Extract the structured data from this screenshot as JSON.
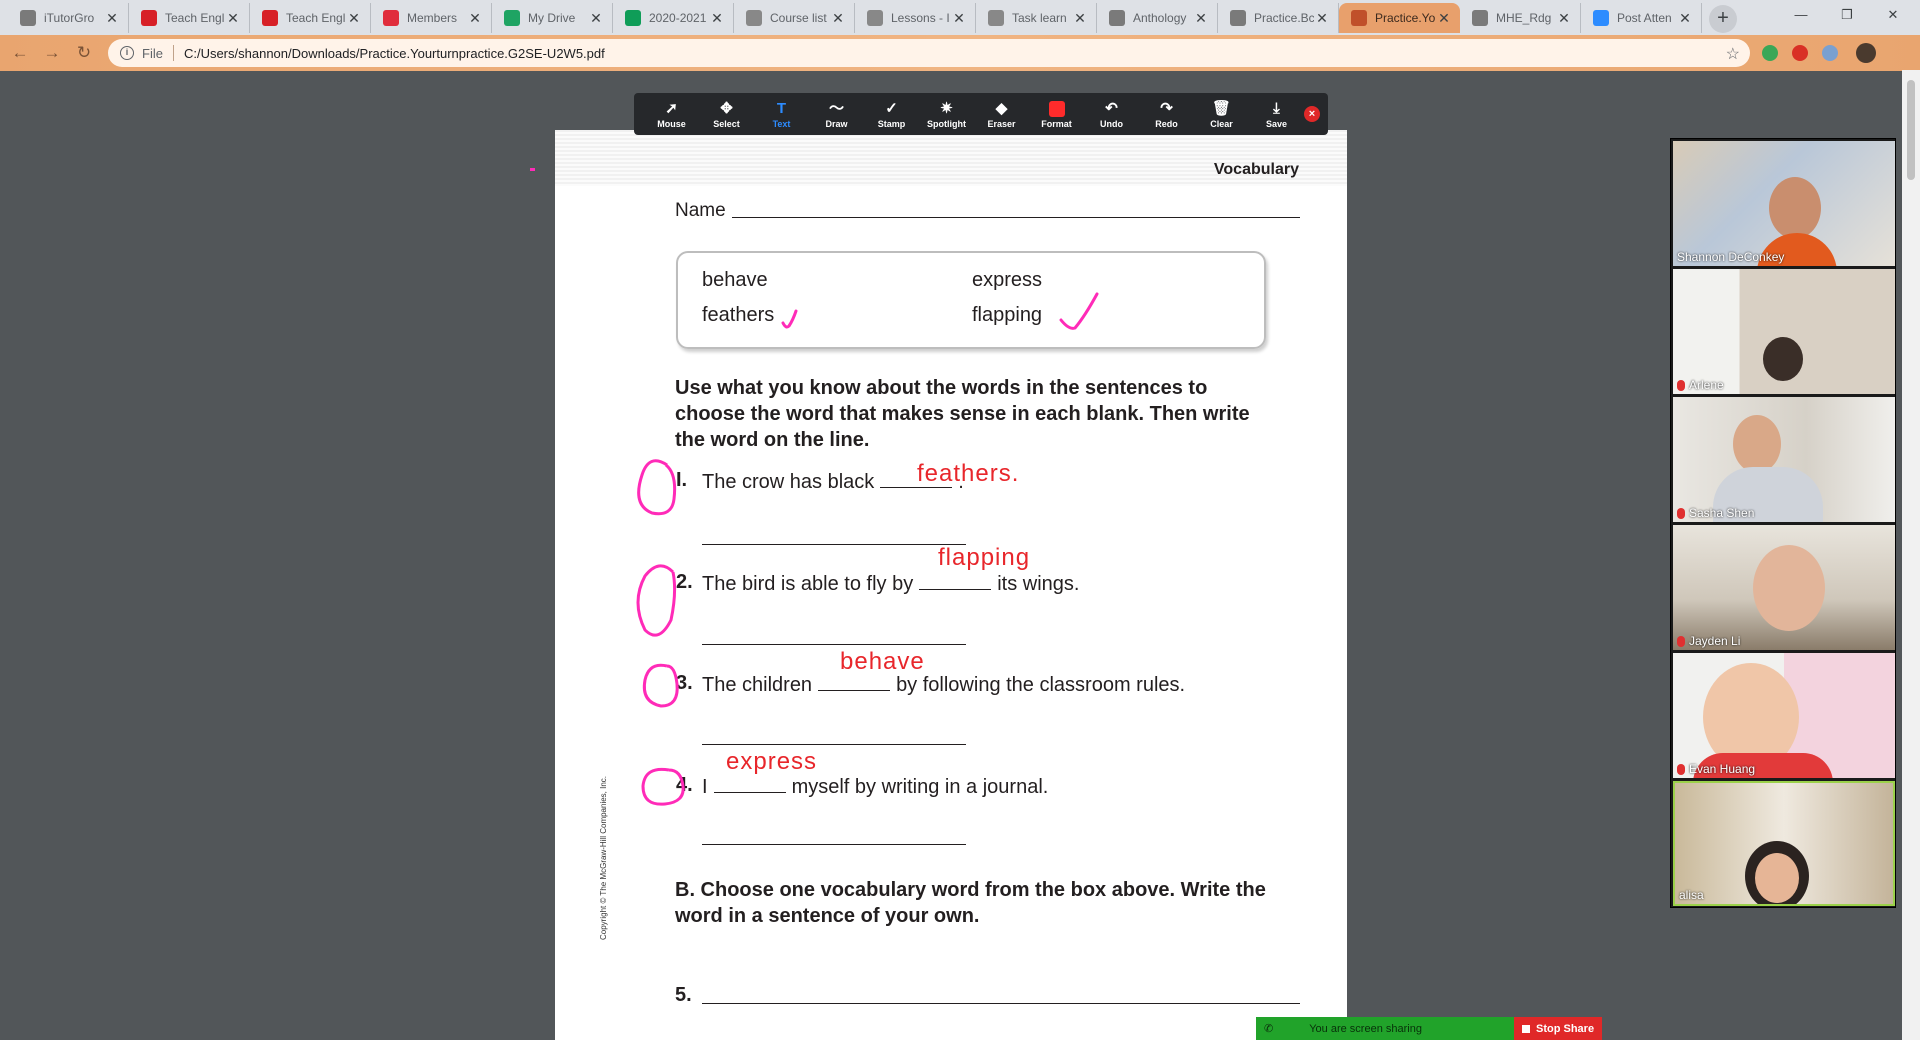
{
  "browser": {
    "tabs": [
      {
        "title": "iTutorGro",
        "icon": "globe-icon",
        "color": "#7a7a7a"
      },
      {
        "title": "Teach Engl",
        "icon": "i-brand-icon",
        "color": "#d72027"
      },
      {
        "title": "Teach Engl",
        "icon": "i-brand-icon",
        "color": "#d72027"
      },
      {
        "title": "Members",
        "icon": "members-icon",
        "color": "#e02d3c"
      },
      {
        "title": "My Drive",
        "icon": "drive-icon",
        "color": "#1fa463"
      },
      {
        "title": "2020-2021",
        "icon": "sheets-icon",
        "color": "#0f9d58"
      },
      {
        "title": "Course list",
        "icon": "doc-icon",
        "color": "#888888"
      },
      {
        "title": "Lessons - I",
        "icon": "doc-icon",
        "color": "#888888"
      },
      {
        "title": "Task learn",
        "icon": "doc-icon",
        "color": "#888888"
      },
      {
        "title": "Anthology",
        "icon": "globe-icon",
        "color": "#7a7a7a"
      },
      {
        "title": "Practice.Bc",
        "icon": "globe-icon",
        "color": "#7a7a7a"
      },
      {
        "title": "Practice.Yo",
        "icon": "pdf-icon",
        "color": "#c0502a"
      },
      {
        "title": "MHE_Rdg",
        "icon": "globe-icon",
        "color": "#7a7a7a"
      },
      {
        "title": "Post Atten",
        "icon": "zoom-icon",
        "color": "#2d8cff"
      }
    ],
    "new_tab": "+",
    "file_label": "File",
    "url": "C:/Users/shannon/Downloads/Practice.Yourturnpractice.G2SE-U2W5.pdf",
    "accent": "#e8a06c"
  },
  "annotation_toolbar": {
    "tools": [
      {
        "label": "Mouse",
        "icon": "cursor-icon",
        "glyph": "➚"
      },
      {
        "label": "Select",
        "icon": "move-icon",
        "glyph": "✥"
      },
      {
        "label": "Text",
        "icon": "text-icon",
        "glyph": "T"
      },
      {
        "label": "Draw",
        "icon": "draw-icon",
        "glyph": "〜"
      },
      {
        "label": "Stamp",
        "icon": "stamp-icon",
        "glyph": "✓"
      },
      {
        "label": "Spotlight",
        "icon": "spotlight-icon",
        "glyph": "✷"
      },
      {
        "label": "Eraser",
        "icon": "eraser-icon",
        "glyph": "◆"
      },
      {
        "label": "Format",
        "icon": "format-icon",
        "glyph": ""
      },
      {
        "label": "Undo",
        "icon": "undo-icon",
        "glyph": "↶"
      },
      {
        "label": "Redo",
        "icon": "redo-icon",
        "glyph": "↷"
      },
      {
        "label": "Clear",
        "icon": "trash-icon",
        "glyph": "🗑"
      },
      {
        "label": "Save",
        "icon": "save-icon",
        "glyph": "⤓"
      }
    ],
    "active_tool": "Text"
  },
  "worksheet": {
    "header": "Vocabulary",
    "name_label": "Name",
    "word_box": [
      "behave",
      "express",
      "feathers",
      "flapping"
    ],
    "instructions": "Use what you know about the words in the sentences to choose the word that makes sense in each blank. Then write the word on the line.",
    "questions": [
      {
        "num": "I.",
        "before": "The crow has black",
        "after": ".",
        "answer": "feathers."
      },
      {
        "num": "2.",
        "before": "The bird is able to fly by",
        "after": "its wings.",
        "answer": "flapping"
      },
      {
        "num": "3.",
        "before": "The children",
        "after": "by following the classroom rules.",
        "answer": "behave"
      },
      {
        "num": "4.",
        "before": "I",
        "after": "myself by writing in a journal.",
        "answer": "express"
      }
    ],
    "section_b": "B. Choose one vocabulary word from the box above. Write the word in a sentence of your own.",
    "q5_num": "5.",
    "copyright": "Copyright © The McGraw-Hill Companies, Inc."
  },
  "participants": [
    {
      "name": "Shannon DeConkey",
      "muted": false,
      "speaking": false
    },
    {
      "name": "Arlene",
      "muted": true,
      "speaking": false
    },
    {
      "name": "Sasha Shen",
      "muted": true,
      "speaking": false
    },
    {
      "name": "Jayden Li",
      "muted": true,
      "speaking": false
    },
    {
      "name": "Evan Huang",
      "muted": true,
      "speaking": false
    },
    {
      "name": "alisa",
      "muted": false,
      "speaking": true
    }
  ],
  "share_bar": {
    "status": "You are screen sharing",
    "stop_label": "Stop Share"
  }
}
